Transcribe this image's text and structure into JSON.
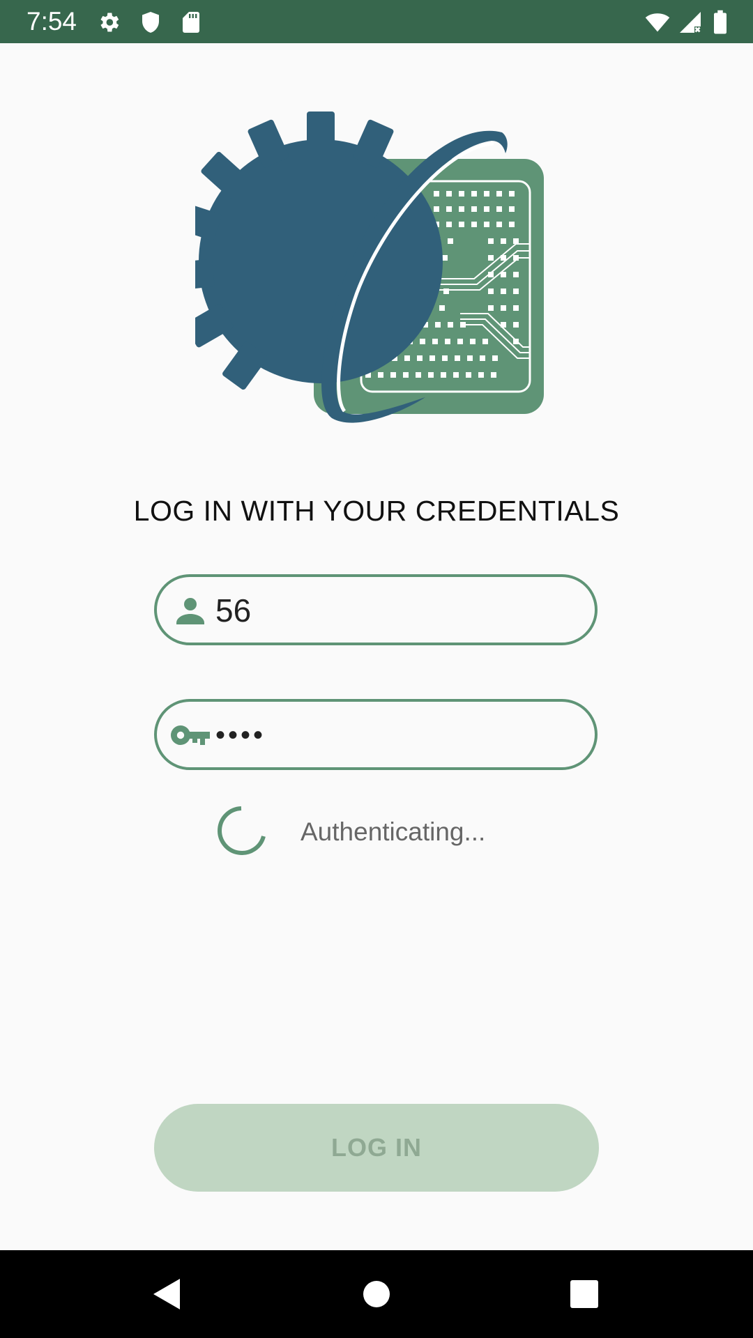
{
  "status_bar": {
    "time": "7:54",
    "icons_left": [
      "gear-icon",
      "shield-icon",
      "sd-card-icon"
    ],
    "icons_right": [
      "wifi-icon",
      "signal-no-data-icon",
      "battery-icon"
    ],
    "background_color": "#37674d"
  },
  "logo": {
    "gear_color": "#31607a",
    "chip_color": "#5f9476"
  },
  "login": {
    "title": "LOG IN WITH YOUR CREDENTIALS",
    "username": {
      "icon": "person-icon",
      "value": "56"
    },
    "password": {
      "icon": "key-icon",
      "masked_value": "••••"
    },
    "status_text": "Authenticating...",
    "button_label": "LOG IN",
    "accent_color": "#5f9476",
    "button_color": "#c0d6c2"
  },
  "nav_bar": {
    "buttons": [
      "back-icon",
      "home-icon",
      "recents-icon"
    ]
  }
}
